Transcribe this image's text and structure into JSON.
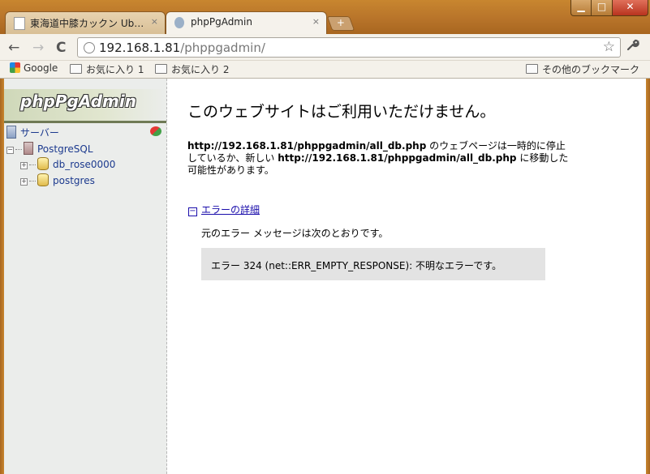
{
  "browser": {
    "tabs": [
      {
        "title": "東海道中膝カックン Ub…",
        "active": false
      },
      {
        "title": "phpPgAdmin",
        "active": true
      }
    ],
    "new_tab_glyph": "+",
    "tab_close_glyph": "×",
    "window_controls": {
      "minimize": "▁",
      "maximize": "□",
      "close": "✕"
    },
    "nav": {
      "back": "←",
      "forward": "→",
      "reload": "C"
    },
    "url": {
      "host": "192.168.1.81",
      "path": "/phppgadmin/"
    },
    "star_glyph": "☆",
    "wrench_glyph": "🔧",
    "bookmarks": {
      "items": [
        "Google",
        "お気に入り 1",
        "お気に入り 2"
      ],
      "other": "その他のブックマーク"
    }
  },
  "sidebar": {
    "logo": "phpPgAdmin",
    "tree": {
      "root": "サーバー",
      "server": "PostgreSQL",
      "databases": [
        "db_rose0000",
        "postgres"
      ]
    }
  },
  "error_page": {
    "title": "このウェブサイトはご利用いただけません。",
    "desc_url_1": "http://192.168.1.81/phppgadmin/all_db.php",
    "desc_text_1": " のウェブページは一時的に停止しているか、新しい ",
    "desc_url_2": "http://192.168.1.81/phppgadmin/all_db.php",
    "desc_text_2": " に移動した可能性があります。",
    "details_box_glyph": "−",
    "details_label": "エラーの詳細",
    "intro": "元のエラー メッセージは次のとおりです。",
    "error_message": "エラー 324 (net::ERR_EMPTY_RESPONSE): 不明なエラーです。"
  },
  "colors": {
    "frame": "#b8742a",
    "link": "#1a0dab",
    "tree_text": "#1c3a8e",
    "error_box_bg": "#e3e3e3"
  }
}
